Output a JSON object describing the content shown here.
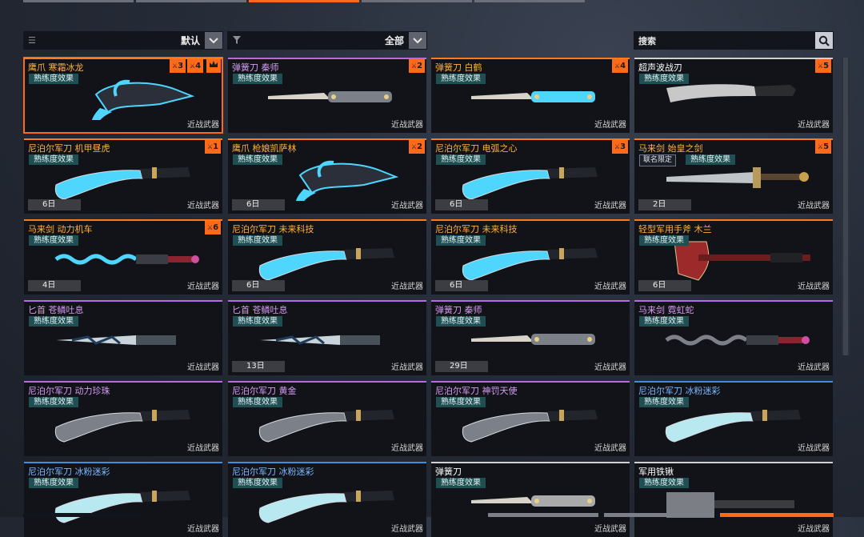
{
  "top_tabs": [
    {
      "active": false
    },
    {
      "active": false
    },
    {
      "active": true
    },
    {
      "active": false
    },
    {
      "active": false
    }
  ],
  "sort": {
    "label": "默认"
  },
  "filter": {
    "label": "全部"
  },
  "search": {
    "placeholder": "搜索"
  },
  "mastery_label": "熟练度效果",
  "category_label": "近战武器",
  "colors": {
    "accent": "#ff6a1a",
    "orange_name": "#ffb23a",
    "purple_name": "#d79cf4",
    "blue_name": "#79b8ff",
    "white_name": "#ffffff",
    "mastery_bg": "#1f4f53"
  },
  "cards": [
    {
      "name": "鹰爪 寒霜冰龙",
      "tier": "orange",
      "selected": true,
      "badges": [
        "3",
        "4",
        "crown"
      ],
      "icon": "claw-icon"
    },
    {
      "name": "弹簧刀 秦师",
      "tier": "purple",
      "badges": [
        "2"
      ],
      "icon": "switchblade-icon"
    },
    {
      "name": "弹簧刀 白鹤",
      "tier": "orange",
      "badges": [
        "4"
      ],
      "icon": "switchblade-icon"
    },
    {
      "name": "超声波战刃",
      "tier": "white",
      "badges": [
        "5"
      ],
      "icon": "machete-icon"
    },
    {
      "name": "尼泊尔军刀 机甲昼虎",
      "tier": "orange",
      "badges": [
        "1"
      ],
      "days": "6日",
      "icon": "kukri-icon"
    },
    {
      "name": "鹰爪 枪娘凯萨林",
      "tier": "orange",
      "badges": [
        "2"
      ],
      "days": "6日",
      "icon": "claw-icon"
    },
    {
      "name": "尼泊尔军刀 电弧之心",
      "tier": "orange",
      "badges": [
        "3"
      ],
      "days": "6日",
      "icon": "kukri-icon"
    },
    {
      "name": "马来剑 始皇之剑",
      "tier": "orange",
      "badges": [
        "5"
      ],
      "days": "2日",
      "limited": "联名限定",
      "icon": "sword-icon"
    },
    {
      "name": "马来剑 动力机车",
      "tier": "orange",
      "badges": [
        "6"
      ],
      "days": "4日",
      "icon": "kris-icon"
    },
    {
      "name": "尼泊尔军刀 未来科技",
      "tier": "orange",
      "days": "6日",
      "icon": "kukri-icon"
    },
    {
      "name": "尼泊尔军刀 未来科技",
      "tier": "orange",
      "days": "6日",
      "icon": "kukri-icon"
    },
    {
      "name": "轻型军用手斧 木兰",
      "tier": "orange",
      "days": "6日",
      "icon": "axe-icon"
    },
    {
      "name": "匕首 苍鳞吐息",
      "tier": "purple",
      "icon": "dagger-icon"
    },
    {
      "name": "匕首 苍鳞吐息",
      "tier": "purple",
      "days": "13日",
      "icon": "dagger-icon"
    },
    {
      "name": "弹簧刀 秦师",
      "tier": "purple",
      "days": "29日",
      "icon": "switchblade-icon"
    },
    {
      "name": "马来剑 霓虹蛇",
      "tier": "purple",
      "icon": "kris-icon"
    },
    {
      "name": "尼泊尔军刀 动力珍珠",
      "tier": "purple",
      "icon": "kukri-icon"
    },
    {
      "name": "尼泊尔军刀 黄金",
      "tier": "purple",
      "icon": "kukri-icon"
    },
    {
      "name": "尼泊尔军刀 神罚天使",
      "tier": "purple",
      "icon": "kukri-icon"
    },
    {
      "name": "尼泊尔军刀 冰粉迷彩",
      "tier": "blue",
      "icon": "kukri-icon"
    },
    {
      "name": "尼泊尔军刀 冰粉迷彩",
      "tier": "blue",
      "icon": "kukri-icon"
    },
    {
      "name": "尼泊尔军刀 冰粉迷彩",
      "tier": "blue",
      "icon": "kukri-icon"
    },
    {
      "name": "弹簧刀",
      "tier": "white",
      "icon": "switchblade-icon"
    },
    {
      "name": "军用铁锹",
      "tier": "white",
      "icon": "shovel-icon"
    }
  ]
}
